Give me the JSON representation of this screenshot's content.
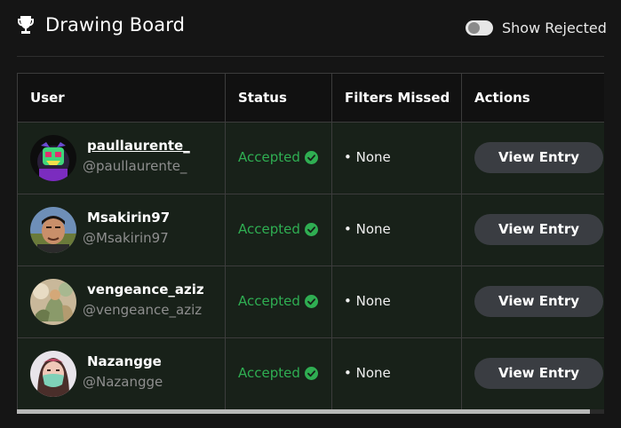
{
  "header": {
    "title": "Drawing Board",
    "icon": "trophy-icon",
    "toggle": {
      "label": "Show Rejected",
      "checked": false
    }
  },
  "table": {
    "columns": [
      "User",
      "Status",
      "Filters Missed",
      "Actions"
    ],
    "rows": [
      {
        "name": "paullaurente_",
        "handle": "@paullaurente_",
        "status": "Accepted",
        "filters": "None",
        "action": "View Entry"
      },
      {
        "name": "Msakirin97",
        "handle": "@Msakirin97",
        "status": "Accepted",
        "filters": "None",
        "action": "View Entry"
      },
      {
        "name": "vengeance_aziz",
        "handle": "@vengeance_aziz",
        "status": "Accepted",
        "filters": "None",
        "action": "View Entry"
      },
      {
        "name": "Nazangge",
        "handle": "@Nazangge",
        "status": "Accepted",
        "filters": "None",
        "action": "View Entry"
      }
    ]
  },
  "colors": {
    "background": "#151515",
    "row_background": "#182119",
    "accepted": "#2fae52",
    "button": "#3a3d42"
  }
}
